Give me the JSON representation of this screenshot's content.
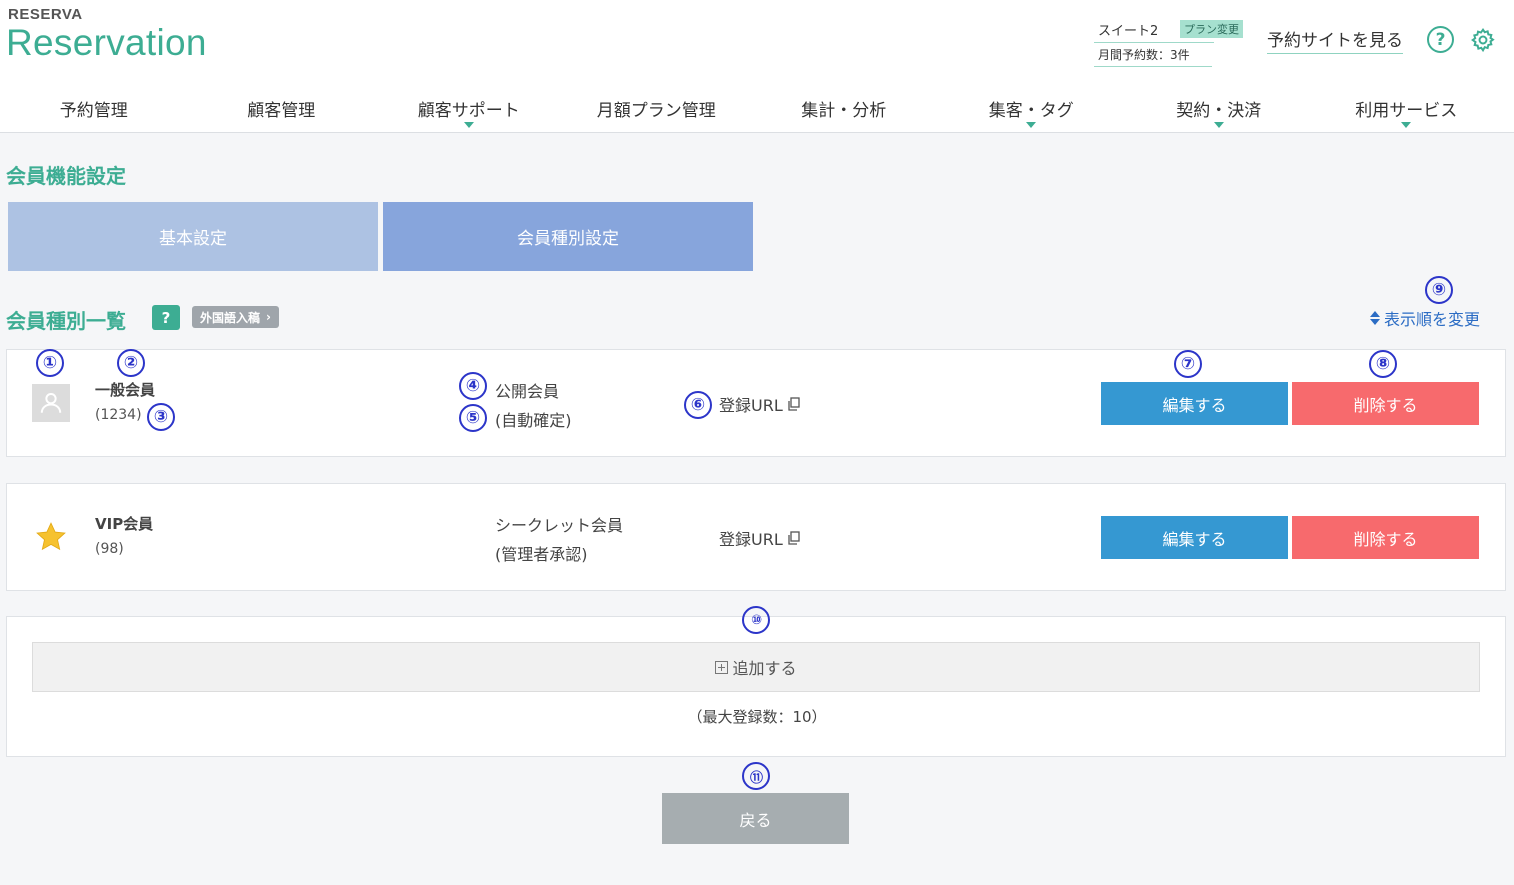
{
  "header": {
    "logo_small": "RESERVA",
    "logo_big": "Reservation",
    "plan_name": "スイート2",
    "plan_change": "プラン変更",
    "monthly_bookings": "月間予約数：3件",
    "view_site": "予約サイトを見る",
    "help_icon": "help-icon",
    "settings_icon": "gear-icon"
  },
  "nav": {
    "items": [
      {
        "label": "予約管理",
        "has_dropdown": false
      },
      {
        "label": "顧客管理",
        "has_dropdown": false
      },
      {
        "label": "顧客サポート",
        "has_dropdown": true
      },
      {
        "label": "月額プラン管理",
        "has_dropdown": false
      },
      {
        "label": "集計・分析",
        "has_dropdown": false
      },
      {
        "label": "集客・タグ",
        "has_dropdown": true
      },
      {
        "label": "契約・決済",
        "has_dropdown": true
      },
      {
        "label": "利用サービス",
        "has_dropdown": true
      }
    ]
  },
  "page": {
    "title": "会員機能設定",
    "tabs": [
      {
        "label": "基本設定",
        "active": false
      },
      {
        "label": "会員種別設定",
        "active": true
      }
    ],
    "section_title": "会員種別一覧",
    "help_badge": "?",
    "foreign_badge": "外国語入稿",
    "sort_link": "表示順を変更"
  },
  "members": [
    {
      "name": "一般会員",
      "count": "(1234)",
      "visibility": "公開会員",
      "approval": "(自動確定)",
      "reg_url": "登録URL",
      "edit": "編集する",
      "delete": "削除する",
      "icon": "user-avatar-icon"
    },
    {
      "name": "VIP会員",
      "count": "(98)",
      "visibility": "シークレット会員",
      "approval": "(管理者承認)",
      "reg_url": "登録URL",
      "edit": "編集する",
      "delete": "削除する",
      "icon": "star-icon"
    }
  ],
  "add_panel": {
    "add_label": "追加する",
    "max_note": "（最大登録数：10）"
  },
  "back_label": "戻る",
  "markers": [
    "①",
    "②",
    "③",
    "④",
    "⑤",
    "⑥",
    "⑦",
    "⑧",
    "⑨",
    "⑩",
    "⑪"
  ],
  "colors": {
    "brand": "#3dad93",
    "edit": "#3598d2",
    "delete": "#f76a6d",
    "tab_active": "#87a5dc",
    "tab_inactive": "#adc2e3",
    "back": "#a6adb0",
    "marker": "#2c35c9"
  }
}
